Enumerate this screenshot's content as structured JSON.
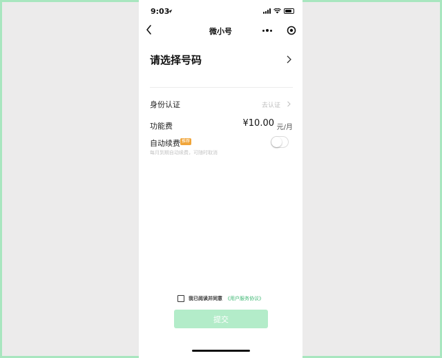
{
  "status_bar": {
    "time": "9:03"
  },
  "nav": {
    "title": "微小号"
  },
  "select_number": {
    "label": "请选择号码"
  },
  "identity": {
    "label": "身份认证",
    "action": "去认证"
  },
  "fee": {
    "label": "功能费",
    "price": "¥10.00",
    "unit": "元/月"
  },
  "auto_renew": {
    "label": "自动续费",
    "badge": "推荐",
    "description": "每月到期自动续费，可随时取消",
    "enabled": false
  },
  "agreement": {
    "text": "我已阅读并同意",
    "link": "《用户服务协议》",
    "checked": false
  },
  "submit": {
    "label": "提交"
  },
  "colors": {
    "accent": "#3fb874",
    "submit_disabled": "#b3ecc9",
    "badge": "#f0a53a",
    "frame": "#a8e6bf"
  }
}
